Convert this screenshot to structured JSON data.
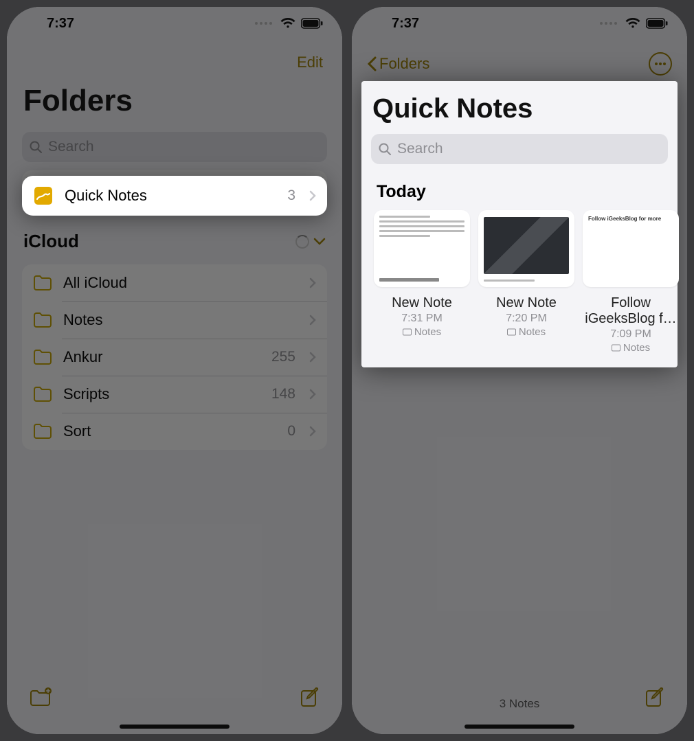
{
  "status_bar": {
    "time": "7:37"
  },
  "left_screen": {
    "nav": {
      "edit": "Edit"
    },
    "title": "Folders",
    "search_placeholder": "Search",
    "quick_notes_row": {
      "label": "Quick Notes",
      "count": "3"
    },
    "icloud_section": {
      "title": "iCloud"
    },
    "folders": [
      {
        "label": "All iCloud",
        "count": ""
      },
      {
        "label": "Notes",
        "count": ""
      },
      {
        "label": "Ankur",
        "count": "255"
      },
      {
        "label": "Scripts",
        "count": "148"
      },
      {
        "label": "Sort",
        "count": "0"
      }
    ]
  },
  "right_screen": {
    "back_label": "Folders",
    "title": "Quick Notes",
    "search_placeholder": "Search",
    "section": "Today",
    "notes": [
      {
        "title": "New Note",
        "time": "7:31 PM",
        "folder": "Notes",
        "thumb_text": ""
      },
      {
        "title": "New Note",
        "time": "7:20 PM",
        "folder": "Notes",
        "thumb_text": ""
      },
      {
        "title": "Follow iGeeksBlog f…",
        "time": "7:09 PM",
        "folder": "Notes",
        "thumb_text": "Follow iGeeksBlog for more"
      }
    ],
    "footer": "3 Notes"
  },
  "colors": {
    "accent": "#c7a600"
  }
}
